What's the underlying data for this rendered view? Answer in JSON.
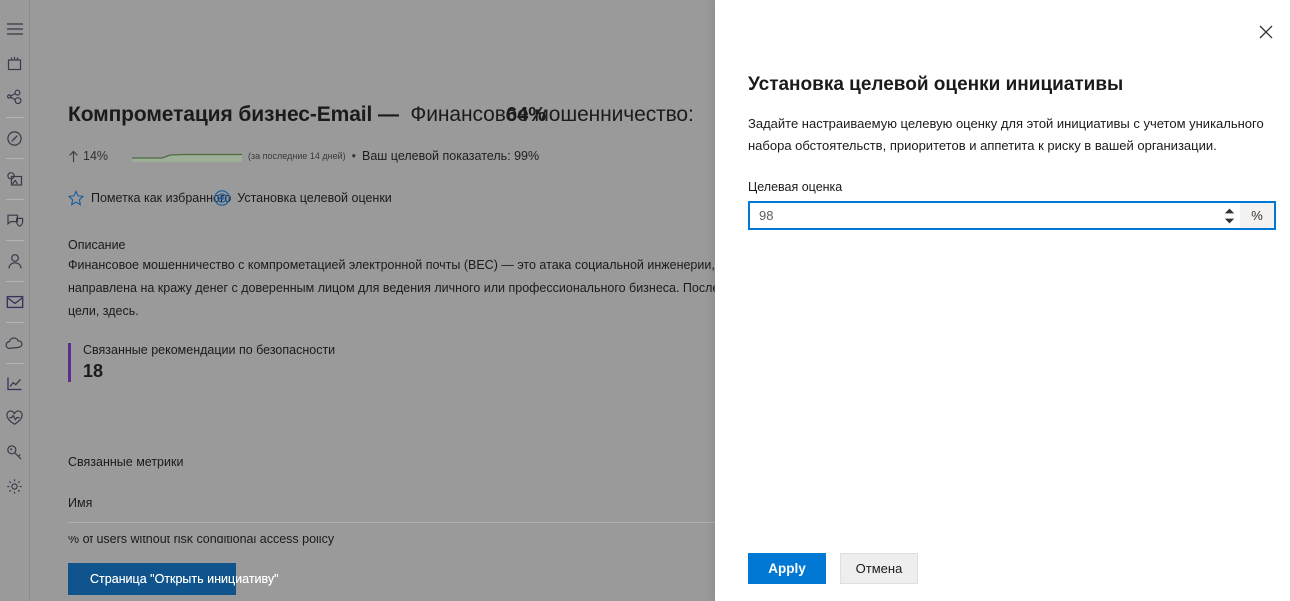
{
  "rail": {
    "items": [
      {
        "name": "hamburger-menu-icon",
        "label": "Меню"
      },
      {
        "name": "home-dashboard-icon",
        "label": "Домашняя страница"
      },
      {
        "name": "incidents-graph-icon",
        "label": "Инциденты"
      },
      {
        "name": "hunting-compass-icon",
        "label": "Поиск"
      },
      {
        "name": "threat-analytics-icon",
        "label": "Аналитика угроз"
      },
      {
        "name": "device-shield-icon",
        "label": "Устройства"
      },
      {
        "name": "identities-person-icon",
        "label": "Удостоверения"
      },
      {
        "name": "email-envelope-icon",
        "label": "Электронная почта"
      },
      {
        "name": "cloud-apps-icon",
        "label": "Облачные приложения"
      },
      {
        "name": "reports-chart-icon",
        "label": "Отчеты"
      },
      {
        "name": "secure-score-heart-icon",
        "label": "Оценка безопасности"
      },
      {
        "name": "permissions-key-icon",
        "label": "Разрешения"
      },
      {
        "name": "settings-gear-icon",
        "label": "Параметры"
      }
    ]
  },
  "main": {
    "title_strong": "Компрометация бизнес-Email —",
    "title_rest": "Финансовое мошенничество:",
    "score_overlay": "64%",
    "trend": {
      "arrow": "↑",
      "percent": "14%",
      "sparkline_note": "(за последние 14 дней)",
      "separator": "•",
      "target_note": "Ваш целевой показатель: 99%",
      "sparkline_values": [
        3,
        3,
        3,
        3,
        4,
        5,
        6,
        6,
        6,
        6,
        6,
        6,
        6,
        6
      ],
      "sparkline_color": "#5a7a52"
    },
    "actions": {
      "favorite_label": "Пометка как избранного",
      "favorite_icon": "star-icon",
      "set_target_label": "Установка целевой оценки",
      "set_target_icon": "target-bullseye-icon"
    },
    "description_label": "Описание",
    "description_text": "Финансовое мошенничество с компрометацией электронной почты (BEC) — это атака социальной инженерии, которая направлена на кражу денег с доверенным лицом для ведения личного или профессионального бизнеса. После обмана цели, здесь.",
    "recommendations": {
      "title": "Связанные рекомендации по безопасности",
      "count": "18",
      "accent_color": "#5c2d91"
    },
    "metrics": {
      "section_label": "Связанные метрики",
      "column_header": "Имя",
      "rows": [
        "% of users without risk conditional access policy"
      ]
    },
    "open_button_label": "Страница \"Открыть инициативу\"",
    "open_button_color": "#0f548c"
  },
  "panel": {
    "close_icon": "close-icon",
    "title": "Установка целевой оценки инициативы",
    "description": "Задайте настраиваемую целевую оценку для этой инициативы с учетом уникального набора обстоятельств, приоритетов и аппетита к риску в вашей организации.",
    "field_label": "Целевая оценка",
    "field_value": "98",
    "field_suffix": "%",
    "spinner_up_icon": "chevron-up-icon",
    "spinner_down_icon": "chevron-down-icon",
    "focus_color": "#0078d4",
    "apply_label": "Apply",
    "cancel_label": "Отмена"
  }
}
